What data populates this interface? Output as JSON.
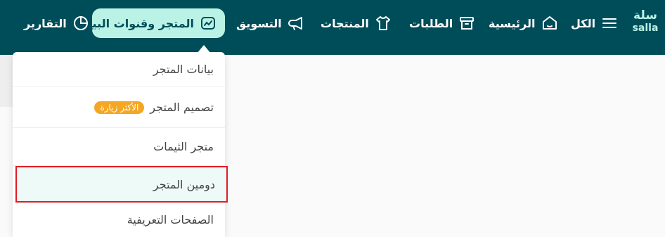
{
  "brand": {
    "logo_ar": "سلة",
    "logo_en": "salla"
  },
  "nav": {
    "all": "الكل",
    "home": "الرئيسية",
    "orders": "الطلبات",
    "products": "المنتجات",
    "marketing": "التسويق",
    "store": "المتجر وقنوات البيع",
    "reports": "التقارير"
  },
  "dropdown": {
    "items": [
      {
        "label": "بيانات المتجر"
      },
      {
        "label": "تصميم المتجر",
        "badge": "الأكثر زيارة"
      },
      {
        "label": "متجر الثيمات"
      },
      {
        "label": "دومين المتجر"
      },
      {
        "label": "الصفحات التعريفية"
      }
    ]
  },
  "colors": {
    "topbar": "#004d5a",
    "accent": "#baf3e6",
    "badge": "#f5a623",
    "highlight_border": "#e11d24"
  }
}
